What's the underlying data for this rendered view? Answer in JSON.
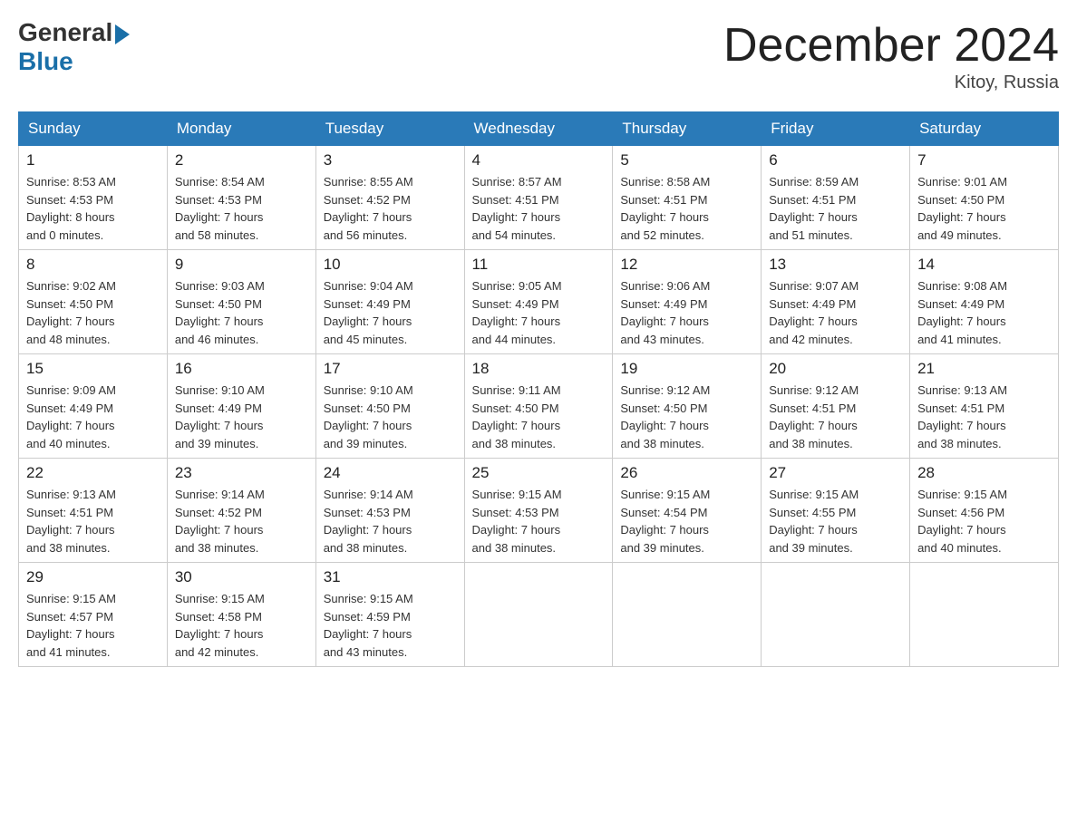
{
  "header": {
    "logo": {
      "general": "General",
      "blue": "Blue",
      "arrow": "▶"
    },
    "title": "December 2024",
    "location": "Kitoy, Russia"
  },
  "weekdays": [
    "Sunday",
    "Monday",
    "Tuesday",
    "Wednesday",
    "Thursday",
    "Friday",
    "Saturday"
  ],
  "weeks": [
    [
      {
        "date": "1",
        "sunrise": "Sunrise: 8:53 AM",
        "sunset": "Sunset: 4:53 PM",
        "daylight": "Daylight: 8 hours",
        "daylight2": "and 0 minutes."
      },
      {
        "date": "2",
        "sunrise": "Sunrise: 8:54 AM",
        "sunset": "Sunset: 4:53 PM",
        "daylight": "Daylight: 7 hours",
        "daylight2": "and 58 minutes."
      },
      {
        "date": "3",
        "sunrise": "Sunrise: 8:55 AM",
        "sunset": "Sunset: 4:52 PM",
        "daylight": "Daylight: 7 hours",
        "daylight2": "and 56 minutes."
      },
      {
        "date": "4",
        "sunrise": "Sunrise: 8:57 AM",
        "sunset": "Sunset: 4:51 PM",
        "daylight": "Daylight: 7 hours",
        "daylight2": "and 54 minutes."
      },
      {
        "date": "5",
        "sunrise": "Sunrise: 8:58 AM",
        "sunset": "Sunset: 4:51 PM",
        "daylight": "Daylight: 7 hours",
        "daylight2": "and 52 minutes."
      },
      {
        "date": "6",
        "sunrise": "Sunrise: 8:59 AM",
        "sunset": "Sunset: 4:51 PM",
        "daylight": "Daylight: 7 hours",
        "daylight2": "and 51 minutes."
      },
      {
        "date": "7",
        "sunrise": "Sunrise: 9:01 AM",
        "sunset": "Sunset: 4:50 PM",
        "daylight": "Daylight: 7 hours",
        "daylight2": "and 49 minutes."
      }
    ],
    [
      {
        "date": "8",
        "sunrise": "Sunrise: 9:02 AM",
        "sunset": "Sunset: 4:50 PM",
        "daylight": "Daylight: 7 hours",
        "daylight2": "and 48 minutes."
      },
      {
        "date": "9",
        "sunrise": "Sunrise: 9:03 AM",
        "sunset": "Sunset: 4:50 PM",
        "daylight": "Daylight: 7 hours",
        "daylight2": "and 46 minutes."
      },
      {
        "date": "10",
        "sunrise": "Sunrise: 9:04 AM",
        "sunset": "Sunset: 4:49 PM",
        "daylight": "Daylight: 7 hours",
        "daylight2": "and 45 minutes."
      },
      {
        "date": "11",
        "sunrise": "Sunrise: 9:05 AM",
        "sunset": "Sunset: 4:49 PM",
        "daylight": "Daylight: 7 hours",
        "daylight2": "and 44 minutes."
      },
      {
        "date": "12",
        "sunrise": "Sunrise: 9:06 AM",
        "sunset": "Sunset: 4:49 PM",
        "daylight": "Daylight: 7 hours",
        "daylight2": "and 43 minutes."
      },
      {
        "date": "13",
        "sunrise": "Sunrise: 9:07 AM",
        "sunset": "Sunset: 4:49 PM",
        "daylight": "Daylight: 7 hours",
        "daylight2": "and 42 minutes."
      },
      {
        "date": "14",
        "sunrise": "Sunrise: 9:08 AM",
        "sunset": "Sunset: 4:49 PM",
        "daylight": "Daylight: 7 hours",
        "daylight2": "and 41 minutes."
      }
    ],
    [
      {
        "date": "15",
        "sunrise": "Sunrise: 9:09 AM",
        "sunset": "Sunset: 4:49 PM",
        "daylight": "Daylight: 7 hours",
        "daylight2": "and 40 minutes."
      },
      {
        "date": "16",
        "sunrise": "Sunrise: 9:10 AM",
        "sunset": "Sunset: 4:49 PM",
        "daylight": "Daylight: 7 hours",
        "daylight2": "and 39 minutes."
      },
      {
        "date": "17",
        "sunrise": "Sunrise: 9:10 AM",
        "sunset": "Sunset: 4:50 PM",
        "daylight": "Daylight: 7 hours",
        "daylight2": "and 39 minutes."
      },
      {
        "date": "18",
        "sunrise": "Sunrise: 9:11 AM",
        "sunset": "Sunset: 4:50 PM",
        "daylight": "Daylight: 7 hours",
        "daylight2": "and 38 minutes."
      },
      {
        "date": "19",
        "sunrise": "Sunrise: 9:12 AM",
        "sunset": "Sunset: 4:50 PM",
        "daylight": "Daylight: 7 hours",
        "daylight2": "and 38 minutes."
      },
      {
        "date": "20",
        "sunrise": "Sunrise: 9:12 AM",
        "sunset": "Sunset: 4:51 PM",
        "daylight": "Daylight: 7 hours",
        "daylight2": "and 38 minutes."
      },
      {
        "date": "21",
        "sunrise": "Sunrise: 9:13 AM",
        "sunset": "Sunset: 4:51 PM",
        "daylight": "Daylight: 7 hours",
        "daylight2": "and 38 minutes."
      }
    ],
    [
      {
        "date": "22",
        "sunrise": "Sunrise: 9:13 AM",
        "sunset": "Sunset: 4:51 PM",
        "daylight": "Daylight: 7 hours",
        "daylight2": "and 38 minutes."
      },
      {
        "date": "23",
        "sunrise": "Sunrise: 9:14 AM",
        "sunset": "Sunset: 4:52 PM",
        "daylight": "Daylight: 7 hours",
        "daylight2": "and 38 minutes."
      },
      {
        "date": "24",
        "sunrise": "Sunrise: 9:14 AM",
        "sunset": "Sunset: 4:53 PM",
        "daylight": "Daylight: 7 hours",
        "daylight2": "and 38 minutes."
      },
      {
        "date": "25",
        "sunrise": "Sunrise: 9:15 AM",
        "sunset": "Sunset: 4:53 PM",
        "daylight": "Daylight: 7 hours",
        "daylight2": "and 38 minutes."
      },
      {
        "date": "26",
        "sunrise": "Sunrise: 9:15 AM",
        "sunset": "Sunset: 4:54 PM",
        "daylight": "Daylight: 7 hours",
        "daylight2": "and 39 minutes."
      },
      {
        "date": "27",
        "sunrise": "Sunrise: 9:15 AM",
        "sunset": "Sunset: 4:55 PM",
        "daylight": "Daylight: 7 hours",
        "daylight2": "and 39 minutes."
      },
      {
        "date": "28",
        "sunrise": "Sunrise: 9:15 AM",
        "sunset": "Sunset: 4:56 PM",
        "daylight": "Daylight: 7 hours",
        "daylight2": "and 40 minutes."
      }
    ],
    [
      {
        "date": "29",
        "sunrise": "Sunrise: 9:15 AM",
        "sunset": "Sunset: 4:57 PM",
        "daylight": "Daylight: 7 hours",
        "daylight2": "and 41 minutes."
      },
      {
        "date": "30",
        "sunrise": "Sunrise: 9:15 AM",
        "sunset": "Sunset: 4:58 PM",
        "daylight": "Daylight: 7 hours",
        "daylight2": "and 42 minutes."
      },
      {
        "date": "31",
        "sunrise": "Sunrise: 9:15 AM",
        "sunset": "Sunset: 4:59 PM",
        "daylight": "Daylight: 7 hours",
        "daylight2": "and 43 minutes."
      },
      null,
      null,
      null,
      null
    ]
  ]
}
